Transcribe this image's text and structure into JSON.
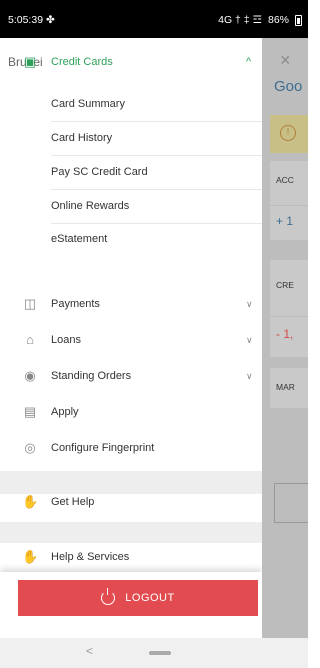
{
  "status": {
    "time": "5:05:39",
    "extra": "✤",
    "icons": "4G † ‡ ☲ ",
    "battery": "86%"
  },
  "drawer": {
    "region": "Brunei",
    "credit_cards": {
      "label": "Credit Cards",
      "chevron": "^",
      "items": [
        "Card Summary",
        "Card History",
        "Pay SC Credit Card",
        "Online Rewards",
        "eStatement"
      ]
    },
    "menu": [
      {
        "label": "Payments",
        "chevron": "∨"
      },
      {
        "label": "Loans",
        "chevron": "∨"
      },
      {
        "label": "Standing Orders",
        "chevron": "∨"
      },
      {
        "label": "Apply"
      },
      {
        "label": "Configure Fingerprint"
      }
    ],
    "get_help": "Get Help",
    "help_services": "Help & Services",
    "logout": "LOGOUT"
  },
  "background": {
    "close": "×",
    "greeting": "Goo",
    "warn": "!",
    "acc_label": "ACC",
    "acc_amount": "+ 1",
    "cre_label": "CRE",
    "cre_amount": "- 1,",
    "mar_label": "MAR"
  },
  "nav": {
    "back": "<"
  },
  "colors": {
    "accent": "#2e9f5a",
    "logout": "#e24b50",
    "negative": "#d64848",
    "positive": "#3d6e93"
  }
}
